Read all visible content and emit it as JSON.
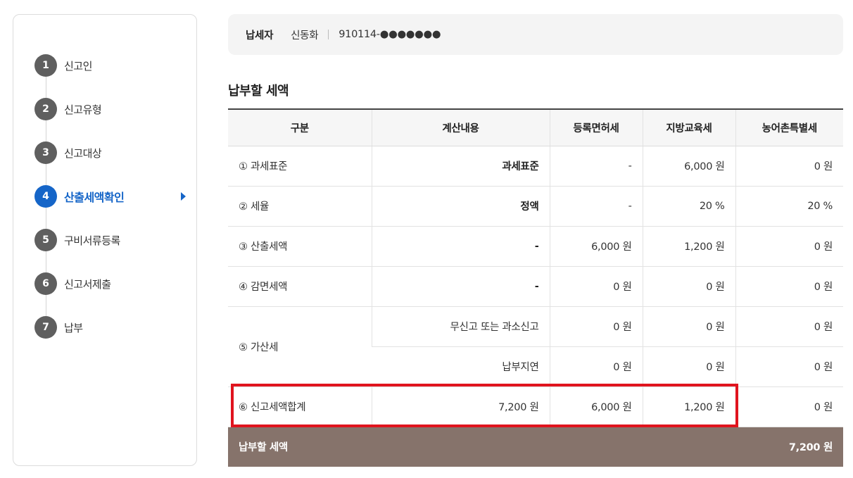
{
  "sidebar": {
    "steps": [
      {
        "num": "1",
        "label": "신고인"
      },
      {
        "num": "2",
        "label": "신고유형"
      },
      {
        "num": "3",
        "label": "신고대상"
      },
      {
        "num": "4",
        "label": "산출세액확인"
      },
      {
        "num": "5",
        "label": "구비서류등록"
      },
      {
        "num": "6",
        "label": "신고서제출"
      },
      {
        "num": "7",
        "label": "납부"
      }
    ],
    "active_step": "4"
  },
  "taxpayer": {
    "label": "납세자",
    "name": "신동화",
    "id": "910114-●●●●●●●"
  },
  "section_title": "납부할 세액",
  "table": {
    "headers": [
      "구분",
      "계산내용",
      "등록면허세",
      "지방교육세",
      "농어촌특별세"
    ],
    "rows": [
      {
        "label": "① 과세표준",
        "calc": "과세표준",
        "reg": "-",
        "edu": "6,000 원",
        "rural": "0 원"
      },
      {
        "label": "② 세율",
        "calc": "정액",
        "reg": "-",
        "edu": "20 %",
        "rural": "20 %"
      },
      {
        "label": "③ 산출세액",
        "calc": "-",
        "reg": "6,000 원",
        "edu": "1,200 원",
        "rural": "0 원"
      },
      {
        "label": "④ 감면세액",
        "calc": "-",
        "reg": "0 원",
        "edu": "0 원",
        "rural": "0 원"
      },
      {
        "label": "⑤ 가산세",
        "calc": "무신고 또는 과소신고",
        "reg": "0 원",
        "edu": "0 원",
        "rural": "0 원"
      },
      {
        "label": "",
        "calc": "납부지연",
        "reg": "0 원",
        "edu": "0 원",
        "rural": "0 원"
      },
      {
        "label": "⑥ 신고세액합계",
        "calc": "7,200 원",
        "reg": "6,000 원",
        "edu": "1,200 원",
        "rural": "0 원"
      }
    ],
    "total": {
      "label": "납부할 세액",
      "value": "7,200 원"
    }
  },
  "colors": {
    "accent": "#1565c8",
    "step_default": "#5f5f5f",
    "total_row_bg": "#86736b",
    "highlight": "#e0141e"
  }
}
